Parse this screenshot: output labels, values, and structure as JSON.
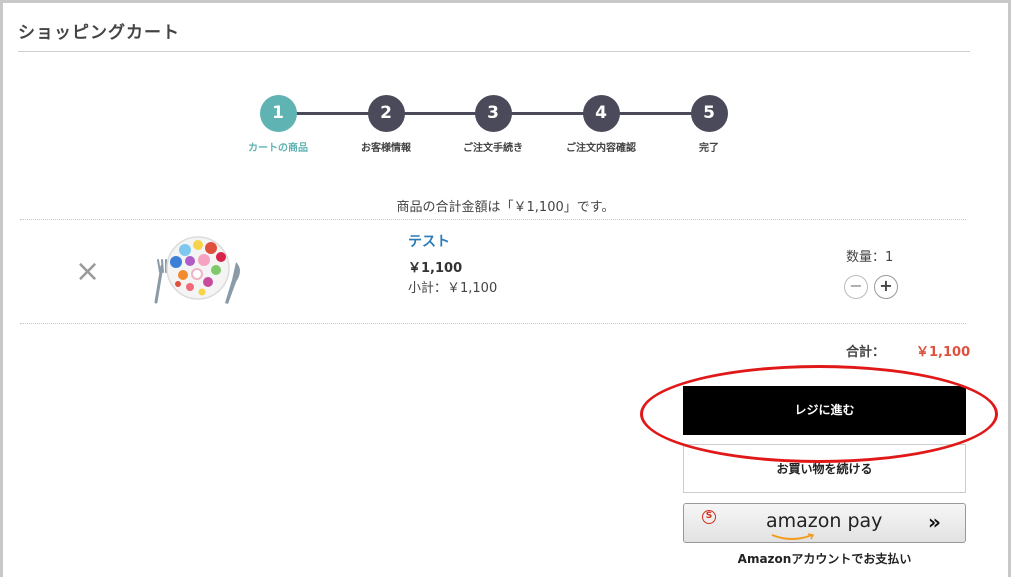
{
  "page": {
    "title": "ショッピングカート"
  },
  "steps": [
    {
      "number": "1",
      "label": "カートの商品",
      "active": true
    },
    {
      "number": "2",
      "label": "お客様情報",
      "active": false
    },
    {
      "number": "3",
      "label": "ご注文手続き",
      "active": false
    },
    {
      "number": "4",
      "label": "ご注文内容確認",
      "active": false
    },
    {
      "number": "5",
      "label": "完了",
      "active": false
    }
  ],
  "cart": {
    "total_message": "商品の合計金額は「￥1,100」です。",
    "item": {
      "remove_icon": "×",
      "name": "テスト",
      "price": "￥1,100",
      "subtotal": "小計：￥1,100",
      "quantity": "数量：1",
      "minus_label": "−",
      "plus_label": "+"
    },
    "sum_label": "合計：",
    "sum_value": "￥1,100"
  },
  "actions": {
    "checkout": "レジに進む",
    "continue": "お買い物を続ける",
    "amazon_pay_logo": "amazon pay",
    "amazon_pay_badge": "S",
    "amazon_pay_arrows": "»",
    "amazon_caption": "Amazonアカウントでお支払い"
  },
  "colors": {
    "accent": "#5fb3b3",
    "step": "#4a4a5a",
    "price": "#e0513d",
    "link": "#2b7bb9",
    "highlight": "#e01818"
  }
}
